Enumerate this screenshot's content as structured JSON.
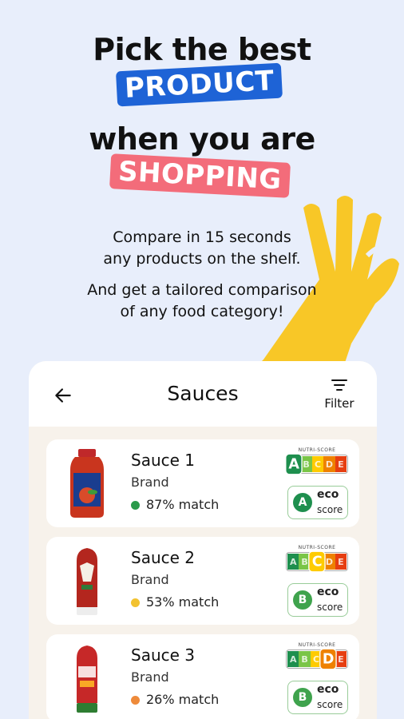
{
  "hero": {
    "line1": "Pick the best",
    "tag1": "PRODUCT",
    "line2": "when you are",
    "tag2": "SHOPPING",
    "sub1": "Compare in 15 seconds",
    "sub2": "any products on the shelf.",
    "sub3": "And get a tailored comparison",
    "sub4": "of any food category!"
  },
  "header": {
    "title": "Sauces",
    "filter_label": "Filter",
    "back_icon": "arrow-left-icon",
    "filter_icon": "filter-icon"
  },
  "nutri_label": "NUTRI-SCORE",
  "nutri_letters": [
    "A",
    "B",
    "C",
    "D",
    "E"
  ],
  "nutri_colors": [
    "#1E8F4E",
    "#7AC547",
    "#FECB02",
    "#EE8100",
    "#E63E11"
  ],
  "eco_label_1": "eco",
  "eco_label_2": "score",
  "products": [
    {
      "name": "Sauce 1",
      "brand": "Brand",
      "match": "87% match",
      "dot_color": "#2A9A4A",
      "nutri": "A",
      "eco": "A"
    },
    {
      "name": "Sauce 2",
      "brand": "Brand",
      "match": "53% match",
      "dot_color": "#F2C230",
      "nutri": "C",
      "eco": "B"
    },
    {
      "name": "Sauce 3",
      "brand": "Brand",
      "match": "26% match",
      "dot_color": "#EE8A3A",
      "nutri": "D",
      "eco": "B"
    }
  ]
}
